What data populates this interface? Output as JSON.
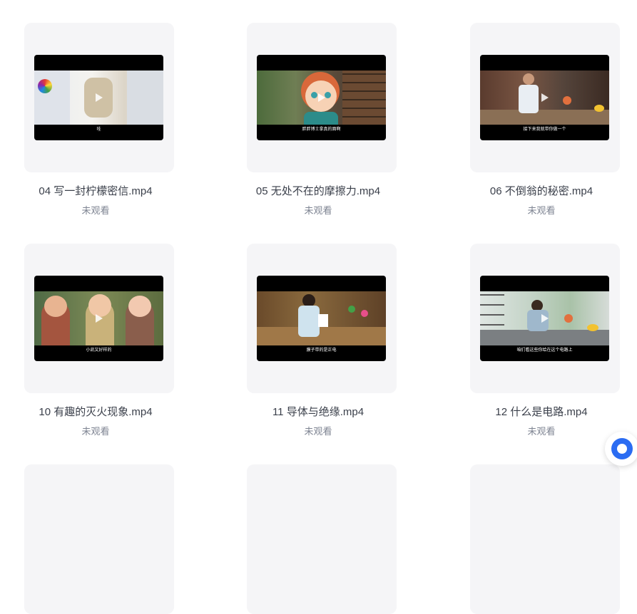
{
  "videos": [
    {
      "title": "04 写一封柠檬密信.mp4",
      "status": "未观看",
      "subtitle": "哇"
    },
    {
      "title": "05 无处不在的摩擦力.mp4",
      "status": "未观看",
      "subtitle": "胖胖博士拿真的面啊"
    },
    {
      "title": "06 不倒翁的秘密.mp4",
      "status": "未观看",
      "subtitle": "接下来我就带你做一个"
    },
    {
      "title": "10 有趣的灭火现象.mp4",
      "status": "未观看",
      "subtitle": "小凯又好样的"
    },
    {
      "title": "11 导体与绝缘.mp4",
      "status": "未观看",
      "subtitle": "膜子带的是正电"
    },
    {
      "title": "12 什么是电路.mp4",
      "status": "未观看",
      "subtitle": "咱们看这些你给在这个电路上"
    }
  ],
  "colors": {
    "card_bg": "#f5f5f7",
    "title": "#3a3f4a",
    "status": "#7d8391",
    "accent": "#2b6cf2"
  },
  "floating_button": {
    "icon": "chat-assistant-icon"
  }
}
